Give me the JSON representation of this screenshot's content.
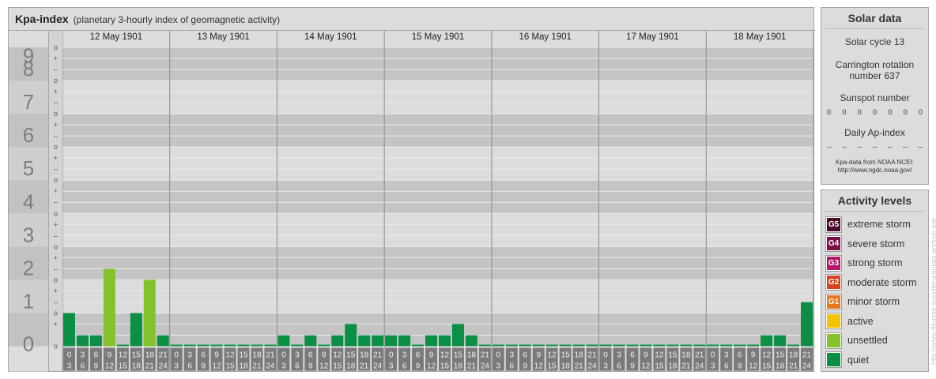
{
  "header": {
    "title": "Kpa-index",
    "subtitle": "(planetary 3-hourly index of geomagnetic activity)"
  },
  "chart_data": {
    "type": "bar",
    "ylim": [
      0,
      9
    ],
    "y_major_ticks": [
      "0",
      "1",
      "2",
      "3",
      "4",
      "5",
      "6",
      "7",
      "8",
      "9"
    ],
    "y_minor_tick_pattern": [
      "+",
      "o",
      "–"
    ],
    "days": [
      "12 May 1901",
      "13 May 1901",
      "14 May 1901",
      "15 May 1901",
      "16 May 1901",
      "17 May 1901",
      "18 May 1901"
    ],
    "interval_labels": [
      [
        "0",
        "3"
      ],
      [
        "3",
        "6"
      ],
      [
        "6",
        "9"
      ],
      [
        "9",
        "12"
      ],
      [
        "12",
        "15"
      ],
      [
        "15",
        "18"
      ],
      [
        "18",
        "21"
      ],
      [
        "21",
        "24"
      ]
    ],
    "values": [
      [
        1.0,
        0.33,
        0.33,
        2.33,
        0,
        1.0,
        2.0,
        0.33
      ],
      [
        0,
        0,
        0,
        0,
        0,
        0,
        0,
        0
      ],
      [
        0.33,
        0,
        0.33,
        0,
        0.33,
        0.67,
        0.33,
        0.33
      ],
      [
        0.33,
        0.33,
        0,
        0.33,
        0.33,
        0.67,
        0.33,
        0
      ],
      [
        0,
        0,
        0,
        0,
        0,
        0,
        0,
        0
      ],
      [
        0,
        0,
        0,
        0,
        0,
        0,
        0,
        0
      ],
      [
        0,
        0,
        0,
        0,
        0.33,
        0.33,
        0,
        1.33
      ]
    ]
  },
  "solar": {
    "title": "Solar data",
    "cycle": "Solar cycle 13",
    "carrington_line1": "Carrington rotation",
    "carrington_line2": "number 637",
    "sunspot_label": "Sunspot number",
    "sunspot_values": [
      "0",
      "0",
      "0",
      "0",
      "0",
      "0",
      "0"
    ],
    "ap_label": "Daily Ap-index",
    "ap_values": [
      "--",
      "--",
      "--",
      "--",
      "--",
      "--",
      "--"
    ],
    "source_line1": "Kpa-data from NOAA NCEI:",
    "source_line2": "http://www.ngdc.noaa.gov/"
  },
  "activity": {
    "title": "Activity levels",
    "levels": [
      {
        "badge": "G5",
        "label": "extreme storm",
        "color": "#4b0a2a"
      },
      {
        "badge": "G4",
        "label": "severe storm",
        "color": "#7a0f4a"
      },
      {
        "badge": "G3",
        "label": "strong storm",
        "color": "#b3196b"
      },
      {
        "badge": "G2",
        "label": "moderate storm",
        "color": "#d9421c"
      },
      {
        "badge": "G1",
        "label": "minor storm",
        "color": "#e8781e"
      },
      {
        "badge": "",
        "label": "active",
        "color": "#f5c400"
      },
      {
        "badge": "",
        "label": "unsettled",
        "color": "#84c22b"
      },
      {
        "badge": "",
        "label": "quiet",
        "color": "#0b8f45"
      }
    ]
  },
  "watermark": "http://www.fleusse-suyellerurgulagi.archivo.org",
  "colors": {
    "quiet": "#0b8f45",
    "unsettled": "#84c22b",
    "band_dark": "#c4c4c4",
    "band_light": "#dcdcdc",
    "label_box": "#7a7a7a"
  }
}
